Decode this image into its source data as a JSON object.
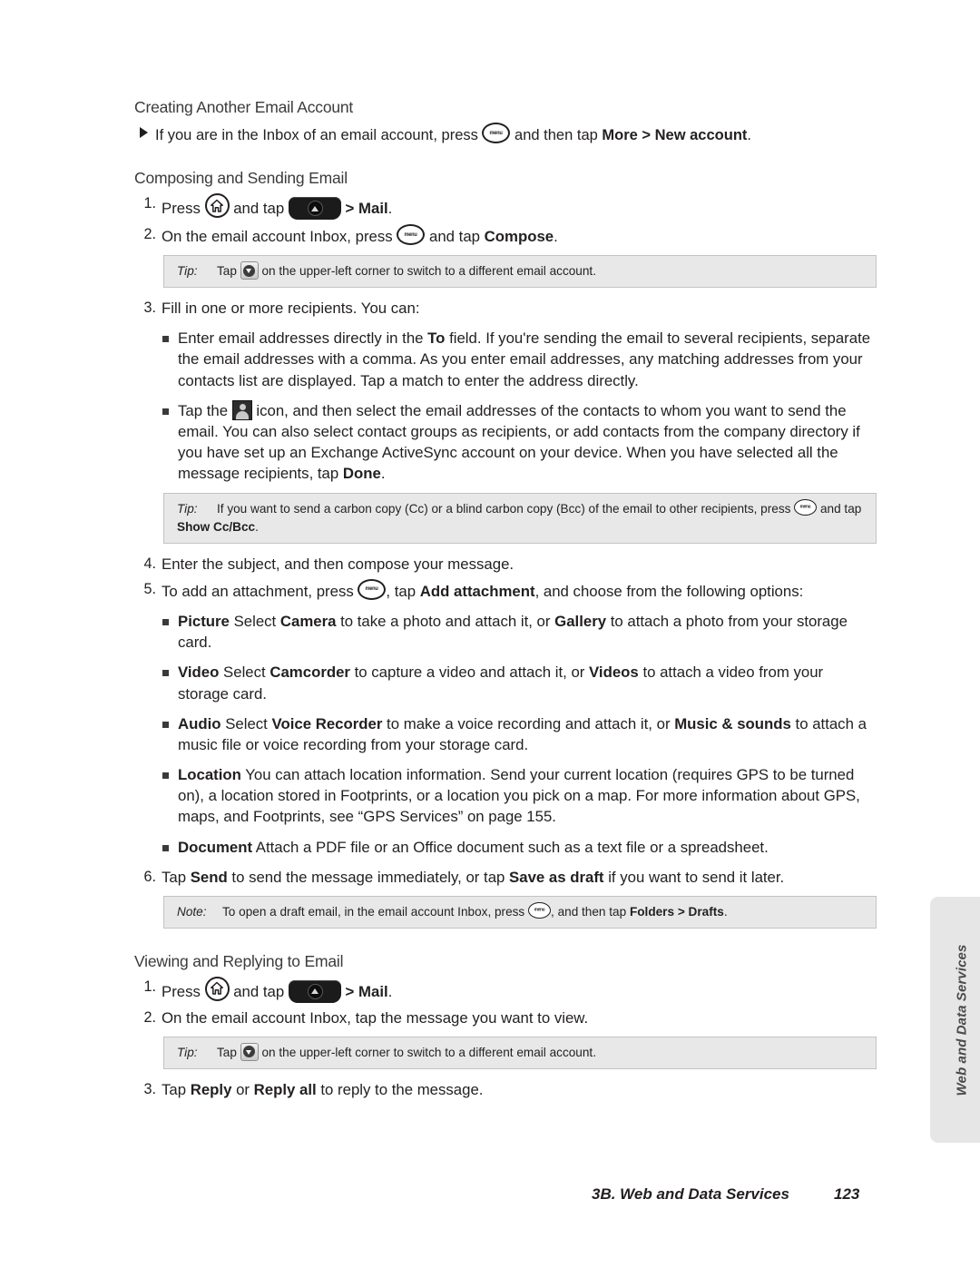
{
  "document": {
    "page_number": "123",
    "footer_chapter": "3B. Web and Data Services",
    "side_tab_label": "Web and Data Services"
  },
  "icons": {
    "menu_label": "menu",
    "menu_name": "menu-hardkey-icon",
    "home_name": "home-hardkey-icon",
    "launcher_name": "launcher-tab-icon",
    "dropdown_name": "dropdown-button-icon",
    "contact_name": "contact-picker-icon"
  },
  "sections": [
    {
      "heading": "Creating Another Email Account",
      "arrow_item": {
        "pre": "If you are in the Inbox of an email account, press ",
        "mid": " and then tap ",
        "bold1": "More",
        "sep": " > ",
        "bold2": "New account",
        "post": "."
      }
    },
    {
      "heading": "Composing and Sending Email"
    },
    {
      "heading": "Viewing and Replying to Email"
    }
  ],
  "composing_steps": {
    "step1": {
      "num": "1.",
      "pre": "Press ",
      "mid": " and tap ",
      "sep": " > ",
      "bold": "Mail",
      "post": "."
    },
    "step2": {
      "num": "2.",
      "pre": "On the email account Inbox, press ",
      "mid": " and tap ",
      "bold": "Compose",
      "post": "."
    },
    "tip1": {
      "label": "Tip:",
      "pre": "Tap ",
      "post": " on the upper-left corner to switch to a different email account."
    },
    "step3": {
      "num": "3.",
      "text": "Fill in one or more recipients. You can:",
      "bullets": [
        {
          "p1": "Enter email addresses directly in the ",
          "b1": "To",
          "p2": " field. If you're sending the email to several recipients, separate the email addresses with a comma. As you enter email addresses, any matching addresses from your contacts list are displayed. Tap a match to enter the address directly."
        },
        {
          "p1": "Tap the ",
          "p2": " icon, and then select the email addresses of the contacts to whom you want to send the email. You can also select contact groups as recipients, or add contacts from the company directory if you have set up an Exchange ActiveSync account on your device. When you have selected all the message recipients, tap ",
          "b1": "Done",
          "p3": "."
        }
      ]
    },
    "tip2": {
      "label": "Tip:",
      "pre": "If you want to send a carbon copy (Cc) or a blind carbon copy (Bcc) of the email to other recipients, press ",
      "mid": " and tap ",
      "bold": "Show Cc/Bcc",
      "post": "."
    },
    "step4": {
      "num": "4.",
      "text": "Enter the subject, and then compose your message."
    },
    "step5": {
      "num": "5.",
      "pre": "To add an attachment, press ",
      "mid": ", tap ",
      "bold": "Add attachment",
      "post": ", and choose from the following options:",
      "options": [
        {
          "b1": "Picture",
          "p1": " Select ",
          "b2": "Camera",
          "p2": " to take a photo and attach it, or ",
          "b3": "Gallery",
          "p3": " to attach a photo from your storage card."
        },
        {
          "b1": "Video",
          "p1": " Select ",
          "b2": "Camcorder",
          "p2": " to capture a video and attach it, or ",
          "b3": "Videos",
          "p3": " to attach a video from your storage card."
        },
        {
          "b1": "Audio",
          "p1": " Select ",
          "b2": "Voice Recorder",
          "p2": " to make a voice recording and attach it, or ",
          "b3": "Music & sounds",
          "p3": " to attach a music file or voice recording from your storage card."
        },
        {
          "b1": "Location",
          "p1": " You can attach location information. Send your current location (requires GPS to be turned on), a location stored in Footprints, or a location you pick on a map. For more information about GPS, maps, and Footprints, see “GPS Services” on page 155.",
          "b2": "",
          "p2": "",
          "b3": "",
          "p3": ""
        },
        {
          "b1": "Document",
          "p1": " Attach a PDF file or an Office document such as a text file or a spreadsheet.",
          "b2": "",
          "p2": "",
          "b3": "",
          "p3": ""
        }
      ]
    },
    "step6": {
      "num": "6.",
      "pre": "Tap ",
      "b1": "Send",
      "mid": " to send the message immediately, or tap ",
      "b2": "Save as draft",
      "post": " if you want to send it later."
    },
    "note1": {
      "label": "Note:",
      "pre": "To open a draft email, in the email account Inbox, press ",
      "mid": ", and then tap ",
      "bold1": "Folders",
      "sep": " > ",
      "bold2": "Drafts",
      "post": "."
    }
  },
  "viewing_steps": {
    "step1": {
      "num": "1.",
      "pre": "Press ",
      "mid": " and tap ",
      "sep": " > ",
      "bold": "Mail",
      "post": "."
    },
    "step2": {
      "num": "2.",
      "text": "On the email account Inbox, tap the message you want to view."
    },
    "tip3": {
      "label": "Tip:",
      "pre": "Tap ",
      "post": " on the upper-left corner to switch to a different email account."
    },
    "step3": {
      "num": "3.",
      "pre": "Tap ",
      "b1": "Reply",
      "mid": " or ",
      "b2": "Reply all",
      "post": " to reply to the message."
    }
  }
}
